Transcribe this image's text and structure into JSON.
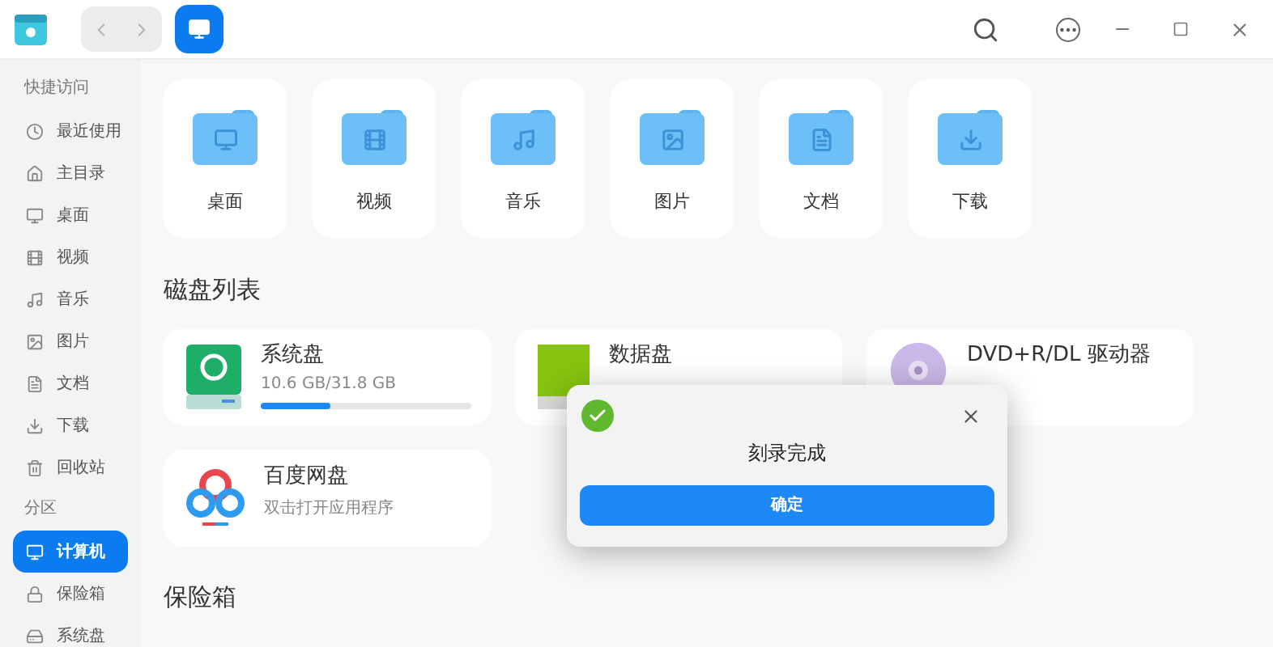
{
  "titlebar": {
    "nav": [
      {
        "disabled": true
      },
      {
        "disabled": true
      }
    ],
    "view_selected": true
  },
  "sidebar": {
    "sections": [
      {
        "title": "快捷访问",
        "items": [
          {
            "label": "最近使用",
            "selected": false
          },
          {
            "label": "主目录",
            "selected": false
          },
          {
            "label": "桌面",
            "selected": false
          },
          {
            "label": "视频",
            "selected": false
          },
          {
            "label": "音乐",
            "selected": false
          },
          {
            "label": "图片",
            "selected": false
          },
          {
            "label": "文档",
            "selected": false
          },
          {
            "label": "下载",
            "selected": false
          },
          {
            "label": "回收站",
            "selected": false
          }
        ]
      },
      {
        "title": "分区",
        "items": [
          {
            "label": "计算机",
            "selected": true
          },
          {
            "label": "保险箱",
            "selected": false
          },
          {
            "label": "系统盘",
            "selected": false
          }
        ]
      }
    ]
  },
  "folders": [
    {
      "label": "桌面"
    },
    {
      "label": "视频"
    },
    {
      "label": "音乐"
    },
    {
      "label": "图片"
    },
    {
      "label": "文档"
    },
    {
      "label": "下载"
    }
  ],
  "disks_heading": "磁盘列表",
  "disks": [
    {
      "kind": "system",
      "name": "系统盘",
      "usage": "10.6 GB/31.8 GB",
      "level": 0.33
    },
    {
      "kind": "data",
      "name": "数据盘"
    },
    {
      "kind": "optical",
      "name": "DVD+R/DL 驱动器"
    },
    {
      "kind": "app",
      "name": "百度网盘",
      "subtitle": "双击打开应用程序"
    }
  ],
  "vault_heading": "保险箱",
  "dialog": {
    "message": "刻录完成",
    "button": "确定"
  }
}
